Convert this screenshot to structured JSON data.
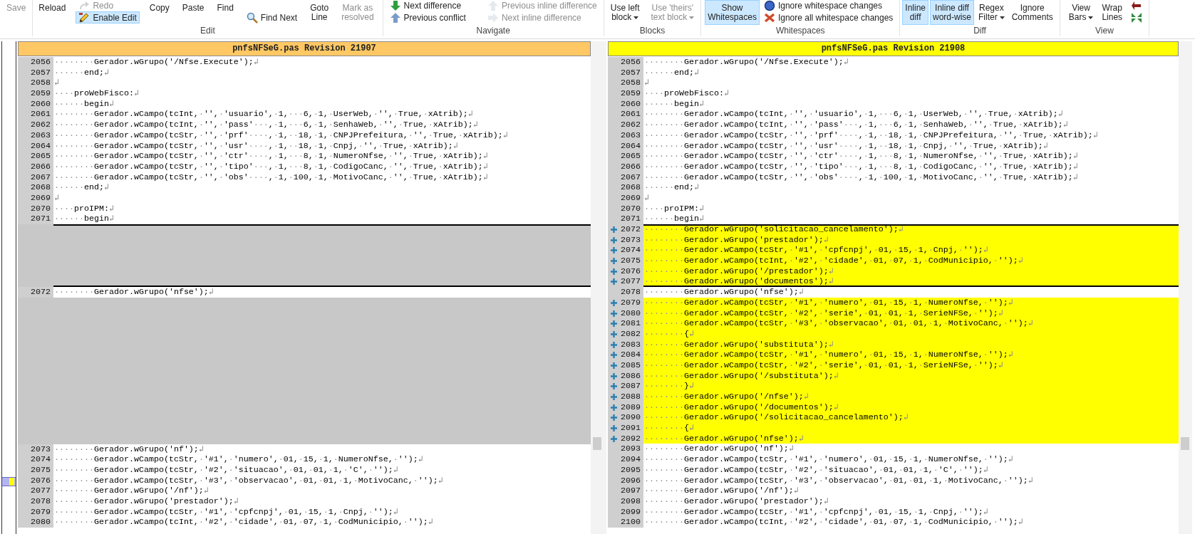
{
  "ribbon": {
    "groups": [
      {
        "columns": [
          {
            "kind": "large",
            "label": "Save",
            "on": false,
            "disabled": true
          }
        ]
      },
      {
        "label": "Edit",
        "columns": [
          {
            "kind": "large",
            "label": "Reload",
            "on": false,
            "disabled": false
          },
          {
            "kind": "stack",
            "items": [
              {
                "label": "Redo",
                "on": false,
                "disabled": true
              },
              {
                "label": "Enable Edit",
                "on": true,
                "disabled": false
              }
            ]
          },
          {
            "kind": "large",
            "label": "Copy",
            "on": false,
            "disabled": false
          },
          {
            "kind": "large",
            "label": "Paste",
            "on": false,
            "disabled": false
          },
          {
            "kind": "large",
            "label": "Find",
            "on": false,
            "disabled": false
          },
          {
            "kind": "stack",
            "items": [
              {
                "label": "Find Next",
                "on": false,
                "disabled": false
              }
            ]
          },
          {
            "kind": "large",
            "label": "Goto\nLine",
            "on": false,
            "disabled": false
          },
          {
            "kind": "large",
            "label": "Mark as\nresolved",
            "on": false,
            "disabled": true
          }
        ]
      },
      {
        "label": "Navigate",
        "columns": [
          {
            "kind": "stack",
            "items": [
              {
                "label": "Next difference",
                "on": false,
                "disabled": false
              },
              {
                "label": "Previous conflict",
                "on": false,
                "disabled": false
              }
            ]
          },
          {
            "kind": "stack",
            "items": [
              {
                "label": "Previous inline difference",
                "on": false,
                "disabled": true
              },
              {
                "label": "Next inline difference",
                "on": false,
                "disabled": true
              }
            ]
          }
        ]
      },
      {
        "label": "Blocks",
        "columns": [
          {
            "kind": "large",
            "label": "Use left\nblock",
            "on": false,
            "disabled": false,
            "dropdown": true
          },
          {
            "kind": "large",
            "label": "Use 'theirs'\ntext block",
            "on": false,
            "disabled": true,
            "dropdown": true
          }
        ]
      },
      {
        "label": "Whitespaces",
        "columns": [
          {
            "kind": "large",
            "label": "Show\nWhitespaces",
            "on": true,
            "disabled": false
          },
          {
            "kind": "stack",
            "items": [
              {
                "label": "Ignore whitespace changes",
                "on": false,
                "disabled": false
              },
              {
                "label": "Ignore all whitespace changes",
                "on": false,
                "disabled": false
              }
            ]
          }
        ]
      },
      {
        "label": "Diff",
        "columns": [
          {
            "kind": "large",
            "label": "Inline\ndiff",
            "on": true,
            "disabled": false
          },
          {
            "kind": "large",
            "label": "Inline diff\nword-wise",
            "on": true,
            "disabled": false
          },
          {
            "kind": "large",
            "label": "Regex\nFilter",
            "on": false,
            "disabled": false,
            "dropdown": true
          },
          {
            "kind": "large",
            "label": "Ignore\nComments",
            "on": false,
            "disabled": false
          }
        ]
      },
      {
        "label": "View",
        "columns": [
          {
            "kind": "large",
            "label": "View\nBars",
            "on": false,
            "disabled": false,
            "dropdown": true
          },
          {
            "kind": "large",
            "label": "Wrap\nLines",
            "on": false,
            "disabled": false
          },
          {
            "kind": "stack",
            "items": [
              {
                "on": false,
                "disabled": false
              },
              {
                "on": false,
                "disabled": false
              }
            ]
          }
        ]
      }
    ]
  },
  "panes": [
    {
      "title": "pnfsNFSeG.pas Revision 21907",
      "kind": "old",
      "blocks": [
        {
          "selected": false,
          "lines": [
            {
              "kind": "same",
              "number": "2056",
              "text": "········Gerador.wGrupo('/Nfse.Execute');↲"
            },
            {
              "kind": "same",
              "number": "2057",
              "text": "······end;↲"
            },
            {
              "kind": "same",
              "number": "2058",
              "text": "↲"
            },
            {
              "kind": "same",
              "number": "2059",
              "text": "····proWebFisco:↲"
            },
            {
              "kind": "same",
              "number": "2060",
              "text": "······begin↲"
            },
            {
              "kind": "same",
              "number": "2061",
              "text": "········Gerador.wCampo(tcInt,·'',·'usuario',·1,···6,·1,·UserWeb,·'',·True,·xAtrib);↲"
            },
            {
              "kind": "same",
              "number": "2062",
              "text": "········Gerador.wCampo(tcInt,·'',·'pass'···,·1,···6,·1,·SenhaWeb,·'',·True,·xAtrib);↲"
            },
            {
              "kind": "same",
              "number": "2063",
              "text": "········Gerador.wCampo(tcStr,·'',·'prf'····,·1,··18,·1,·CNPJPrefeitura,·'',·True,·xAtrib);↲"
            },
            {
              "kind": "same",
              "number": "2064",
              "text": "········Gerador.wCampo(tcStr,·'',·'usr'····,·1,··18,·1,·Cnpj,·'',·True,·xAtrib);↲"
            },
            {
              "kind": "same",
              "number": "2065",
              "text": "········Gerador.wCampo(tcStr,·'',·'ctr'····,·1,···8,·1,·NumeroNfse,·'',·True,·xAtrib);↲"
            },
            {
              "kind": "same",
              "number": "2066",
              "text": "········Gerador.wCampo(tcStr,·'',·'tipo'···,·1,···8,·1,·CodigoCanc,·'',·True,·xAtrib);↲"
            },
            {
              "kind": "same",
              "number": "2067",
              "text": "········Gerador.wCampo(tcStr,·'',·'obs'····,·1,·100,·1,·MotivoCanc,·'',·True,·xAtrib);↲"
            },
            {
              "kind": "same",
              "number": "2068",
              "text": "······end;↲"
            },
            {
              "kind": "same",
              "number": "2069",
              "text": "↲"
            },
            {
              "kind": "same",
              "number": "2070",
              "text": "····proIPM:↲"
            },
            {
              "kind": "same",
              "number": "2071",
              "text": "······begin↲"
            }
          ]
        },
        {
          "selected": true,
          "lines": [
            {
              "kind": "filler"
            },
            {
              "kind": "filler"
            },
            {
              "kind": "filler"
            },
            {
              "kind": "filler"
            },
            {
              "kind": "filler"
            },
            {
              "kind": "filler"
            }
          ]
        },
        {
          "selected": false,
          "lines": [
            {
              "kind": "same",
              "number": "2072",
              "text": "········Gerador.wGrupo('nfse');↲"
            }
          ]
        },
        {
          "selected": false,
          "lines": [
            {
              "kind": "filler"
            },
            {
              "kind": "filler"
            },
            {
              "kind": "filler"
            },
            {
              "kind": "filler"
            },
            {
              "kind": "filler"
            },
            {
              "kind": "filler"
            },
            {
              "kind": "filler"
            },
            {
              "kind": "filler"
            },
            {
              "kind": "filler"
            },
            {
              "kind": "filler"
            },
            {
              "kind": "filler"
            },
            {
              "kind": "filler"
            },
            {
              "kind": "filler"
            },
            {
              "kind": "filler"
            }
          ]
        },
        {
          "selected": false,
          "lines": [
            {
              "kind": "same",
              "number": "2073",
              "text": "········Gerador.wGrupo('nf');↲"
            },
            {
              "kind": "same",
              "number": "2074",
              "text": "········Gerador.wCampo(tcStr,·'#1',·'numero',·01,·15,·1,·NumeroNfse,·'');↲"
            },
            {
              "kind": "same",
              "number": "2075",
              "text": "········Gerador.wCampo(tcStr,·'#2',·'situacao',·01,·01,·1,·'C',·'');↲"
            },
            {
              "kind": "same",
              "number": "2076",
              "text": "········Gerador.wCampo(tcStr,·'#3',·'observacao',·01,·01,·1,·MotivoCanc,·'');↲"
            },
            {
              "kind": "same",
              "number": "2077",
              "text": "········Gerador.wGrupo('/nf');↲"
            },
            {
              "kind": "same",
              "number": "2078",
              "text": "········Gerador.wGrupo('prestador');↲"
            },
            {
              "kind": "same",
              "number": "2079",
              "text": "········Gerador.wCampo(tcStr,·'#1',·'cpfcnpj',·01,·15,·1,·Cnpj,·'');↲"
            },
            {
              "kind": "same",
              "number": "2080",
              "text": "········Gerador.wCampo(tcInt,·'#2',·'cidade',·01,·07,·1,·CodMunicipio,·'');↲"
            }
          ]
        }
      ]
    },
    {
      "title": "pnfsNFSeG.pas Revision 21908",
      "kind": "new",
      "blocks": [
        {
          "selected": false,
          "lines": [
            {
              "kind": "same",
              "number": "2056",
              "text": "········Gerador.wGrupo('/Nfse.Execute');↲"
            },
            {
              "kind": "same",
              "number": "2057",
              "text": "······end;↲"
            },
            {
              "kind": "same",
              "number": "2058",
              "text": "↲"
            },
            {
              "kind": "same",
              "number": "2059",
              "text": "····proWebFisco:↲"
            },
            {
              "kind": "same",
              "number": "2060",
              "text": "······begin↲"
            },
            {
              "kind": "same",
              "number": "2061",
              "text": "········Gerador.wCampo(tcInt,·'',·'usuario',·1,···6,·1,·UserWeb,·'',·True,·xAtrib);↲"
            },
            {
              "kind": "same",
              "number": "2062",
              "text": "········Gerador.wCampo(tcInt,·'',·'pass'···,·1,···6,·1,·SenhaWeb,·'',·True,·xAtrib);↲"
            },
            {
              "kind": "same",
              "number": "2063",
              "text": "········Gerador.wCampo(tcStr,·'',·'prf'····,·1,··18,·1,·CNPJPrefeitura,·'',·True,·xAtrib);↲"
            },
            {
              "kind": "same",
              "number": "2064",
              "text": "········Gerador.wCampo(tcStr,·'',·'usr'····,·1,··18,·1,·Cnpj,·'',·True,·xAtrib);↲"
            },
            {
              "kind": "same",
              "number": "2065",
              "text": "········Gerador.wCampo(tcStr,·'',·'ctr'····,·1,···8,·1,·NumeroNfse,·'',·True,·xAtrib);↲"
            },
            {
              "kind": "same",
              "number": "2066",
              "text": "········Gerador.wCampo(tcStr,·'',·'tipo'···,·1,···8,·1,·CodigoCanc,·'',·True,·xAtrib);↲"
            },
            {
              "kind": "same",
              "number": "2067",
              "text": "········Gerador.wCampo(tcStr,·'',·'obs'····,·1,·100,·1,·MotivoCanc,·'',·True,·xAtrib);↲"
            },
            {
              "kind": "same",
              "number": "2068",
              "text": "······end;↲"
            },
            {
              "kind": "same",
              "number": "2069",
              "text": "↲"
            },
            {
              "kind": "same",
              "number": "2070",
              "text": "····proIPM:↲"
            },
            {
              "kind": "same",
              "number": "2071",
              "text": "······begin↲"
            }
          ]
        },
        {
          "selected": true,
          "lines": [
            {
              "kind": "added",
              "number": "2072",
              "text": "········Gerador.wGrupo('solicitacao_cancelamento');↲"
            },
            {
              "kind": "added",
              "number": "2073",
              "text": "········Gerador.wGrupo('prestador');↲"
            },
            {
              "kind": "added",
              "number": "2074",
              "text": "········Gerador.wCampo(tcStr,·'#1',·'cpfcnpj',·01,·15,·1,·Cnpj,·'');↲"
            },
            {
              "kind": "added",
              "number": "2075",
              "text": "········Gerador.wCampo(tcInt,·'#2',·'cidade',·01,·07,·1,·CodMunicipio,·'');↲"
            },
            {
              "kind": "added",
              "number": "2076",
              "text": "········Gerador.wGrupo('/prestador');↲"
            },
            {
              "kind": "added",
              "number": "2077",
              "text": "········Gerador.wGrupo('documentos');↲"
            }
          ]
        },
        {
          "selected": false,
          "lines": [
            {
              "kind": "same",
              "number": "2078",
              "text": "········Gerador.wGrupo('nfse');↲"
            }
          ]
        },
        {
          "selected": false,
          "lines": [
            {
              "kind": "added",
              "number": "2079",
              "text": "········Gerador.wCampo(tcStr,·'#1',·'numero',·01,·15,·1,·NumeroNfse,·'');↲"
            },
            {
              "kind": "added",
              "number": "2080",
              "text": "········Gerador.wCampo(tcStr,·'#2',·'serie',·01,·01,·1,·SerieNFSe,·'');↲"
            },
            {
              "kind": "added",
              "number": "2081",
              "text": "········Gerador.wCampo(tcStr,·'#3',·'observacao',·01,·01,·1,·MotivoCanc,·'');↲"
            },
            {
              "kind": "added",
              "number": "2082",
              "text": "········{↲"
            },
            {
              "kind": "added",
              "number": "2083",
              "text": "········Gerador.wGrupo('substituta');↲"
            },
            {
              "kind": "added",
              "number": "2084",
              "text": "········Gerador.wCampo(tcStr,·'#1',·'numero',·01,·15,·1,·NumeroNfse,·'');↲"
            },
            {
              "kind": "added",
              "number": "2085",
              "text": "········Gerador.wCampo(tcStr,·'#2',·'serie',·01,·01,·1,·SerieNFSe,·'');↲"
            },
            {
              "kind": "added",
              "number": "2086",
              "text": "········Gerador.wGrupo('/substituta');↲"
            },
            {
              "kind": "added",
              "number": "2087",
              "text": "········}↲"
            },
            {
              "kind": "added",
              "number": "2088",
              "text": "········Gerador.wGrupo('/nfse');↲"
            },
            {
              "kind": "added",
              "number": "2089",
              "text": "········Gerador.wGrupo('/documentos');↲"
            },
            {
              "kind": "added",
              "number": "2090",
              "text": "········Gerador.wGrupo('/solicitacao_cancelamento');↲"
            },
            {
              "kind": "added",
              "number": "2091",
              "text": "········{↲"
            },
            {
              "kind": "added",
              "number": "2092",
              "text": "········Gerador.wGrupo('nfse');↲"
            }
          ]
        },
        {
          "selected": false,
          "lines": [
            {
              "kind": "same",
              "number": "2093",
              "text": "········Gerador.wGrupo('nf');↲"
            },
            {
              "kind": "same",
              "number": "2094",
              "text": "········Gerador.wCampo(tcStr,·'#1',·'numero',·01,·15,·1,·NumeroNfse,·'');↲"
            },
            {
              "kind": "same",
              "number": "2095",
              "text": "········Gerador.wCampo(tcStr,·'#2',·'situacao',·01,·01,·1,·'C',·'');↲"
            },
            {
              "kind": "same",
              "number": "2096",
              "text": "········Gerador.wCampo(tcStr,·'#3',·'observacao',·01,·01,·1,·MotivoCanc,·'');↲"
            },
            {
              "kind": "same",
              "number": "2097",
              "text": "········Gerador.wGrupo('/nf');↲"
            },
            {
              "kind": "same",
              "number": "2098",
              "text": "········Gerador.wGrupo('prestador');↲"
            },
            {
              "kind": "same",
              "number": "2099",
              "text": "········Gerador.wCampo(tcStr,·'#1',·'cpfcnpj',·01,·15,·1,·Cnpj,·'');↲"
            },
            {
              "kind": "same",
              "number": "2100",
              "text": "········Gerador.wCampo(tcInt,·'#2',·'cidade',·01,·07,·1,·CodMunicipio,·'');↲"
            }
          ]
        }
      ]
    }
  ]
}
